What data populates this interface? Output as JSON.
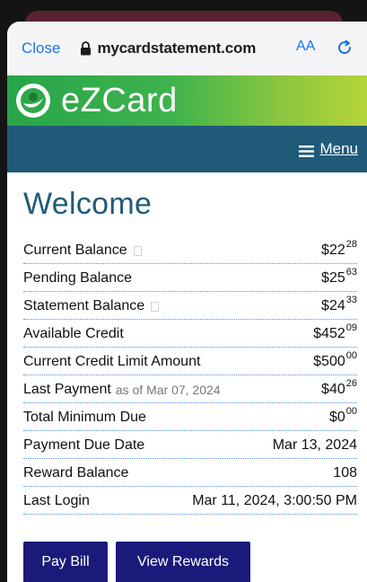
{
  "browser": {
    "close_label": "Close",
    "url": "mycardstatement.com",
    "text_size_label": "AA"
  },
  "brand": {
    "name": "eZCard"
  },
  "nav": {
    "menu_label": "Menu"
  },
  "page": {
    "heading": "Welcome"
  },
  "account": {
    "rows": [
      {
        "label": "Current Balance",
        "dollars": "$22",
        "cents": "28"
      },
      {
        "label": "Pending Balance",
        "dollars": "$25",
        "cents": "63"
      },
      {
        "label": "Statement Balance",
        "dollars": "$24",
        "cents": "33"
      },
      {
        "label": "Available Credit",
        "dollars": "$452",
        "cents": "09"
      },
      {
        "label": "Current Credit Limit Amount",
        "dollars": "$500",
        "cents": "00"
      },
      {
        "label": "Last Payment",
        "note": "as of Mar 07, 2024",
        "dollars": "$40",
        "cents": "26"
      },
      {
        "label": "Total Minimum Due",
        "dollars": "$0",
        "cents": "00"
      },
      {
        "label": "Payment Due Date",
        "value": "Mar 13, 2024"
      },
      {
        "label": "Reward Balance",
        "value": "108"
      },
      {
        "label": "Last Login",
        "value": "Mar 11, 2024, 3:00:50 PM"
      }
    ]
  },
  "actions": {
    "pay_bill_label": "Pay Bill",
    "view_rewards_label": "View Rewards"
  },
  "colors": {
    "brand_blue": "#1f5b79",
    "button_navy": "#1a1a7a",
    "link_blue": "#1a73e8"
  }
}
